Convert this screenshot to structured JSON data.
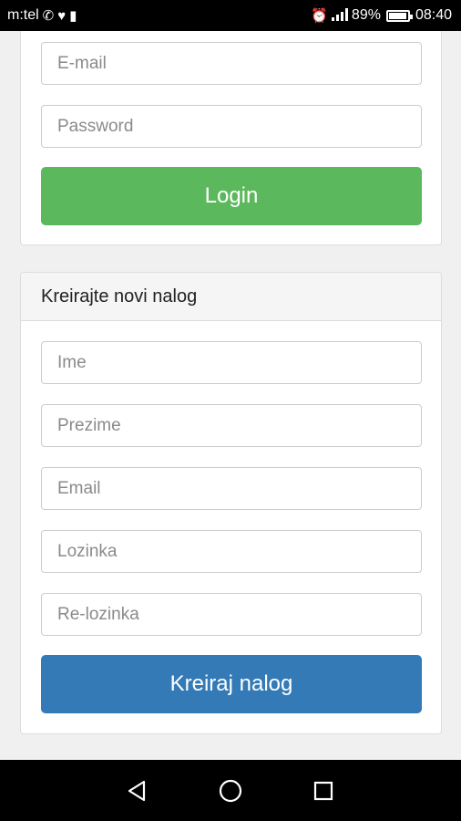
{
  "status_bar": {
    "carrier": "m:tel",
    "battery_percent": "89%",
    "time": "08:40",
    "icons": [
      "phone-icon",
      "heart-icon",
      "notification-icon",
      "alarm-icon",
      "signal-icon",
      "battery-icon"
    ]
  },
  "login": {
    "email_placeholder": "E-mail",
    "password_placeholder": "Password",
    "login_label": "Login"
  },
  "register": {
    "heading": "Kreirajte novi nalog",
    "first_name_placeholder": "Ime",
    "last_name_placeholder": "Prezime",
    "email_placeholder": "Email",
    "password_placeholder": "Lozinka",
    "repassword_placeholder": "Re-lozinka",
    "submit_label": "Kreiraj nalog"
  },
  "colors": {
    "login_button": "#5cb85c",
    "register_button": "#337ab7"
  },
  "nav_bar": {
    "icons": [
      "back-icon",
      "home-icon",
      "recents-icon"
    ]
  }
}
